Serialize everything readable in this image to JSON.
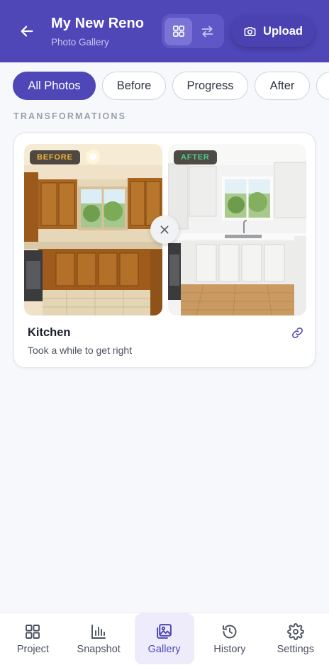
{
  "header": {
    "title": "My New Reno",
    "subtitle": "Photo Gallery",
    "upload_label": "Upload",
    "icons": {
      "back": "arrow-left-icon",
      "grid": "grid-icon",
      "compare": "arrows-swap-icon",
      "upload": "camera-icon"
    },
    "active_view": "grid"
  },
  "filters": {
    "chips": [
      {
        "label": "All Photos",
        "active": true
      },
      {
        "label": "Before",
        "active": false
      },
      {
        "label": "Progress",
        "active": false
      },
      {
        "label": "After",
        "active": false
      }
    ]
  },
  "section": {
    "label": "TRANSFORMATIONS"
  },
  "card": {
    "before_badge": "BEFORE",
    "after_badge": "AFTER",
    "title": "Kitchen",
    "description": "Took a while to get right",
    "icons": {
      "swap": "close-icon",
      "link": "link-icon"
    }
  },
  "bottom_nav": {
    "items": [
      {
        "label": "Project",
        "icon": "grid-icon",
        "active": false
      },
      {
        "label": "Snapshot",
        "icon": "bar-chart-icon",
        "active": false
      },
      {
        "label": "Gallery",
        "icon": "image-gallery-icon",
        "active": true
      },
      {
        "label": "History",
        "icon": "history-clock-icon",
        "active": false
      },
      {
        "label": "Settings",
        "icon": "gear-icon",
        "active": false
      }
    ]
  },
  "colors": {
    "brand": "#4f46b8",
    "before_badge": "#f2b33a",
    "after_badge": "#4ccf86"
  }
}
